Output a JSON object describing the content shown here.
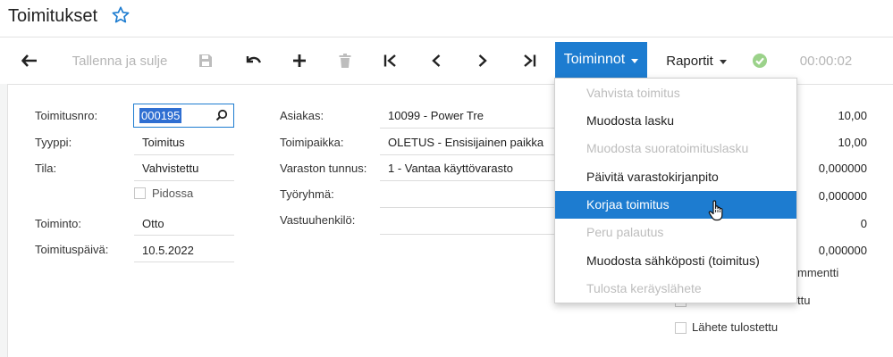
{
  "header": {
    "title": "Toimitukset",
    "favorite_icon": "star-outline-icon"
  },
  "toolbar": {
    "back_icon": "back-arrow-icon",
    "save_close": "Tallenna ja sulje",
    "save_icon": "floppy-disk-icon",
    "undo_icon": "undo-icon",
    "add_icon": "plus-icon",
    "delete_icon": "trash-icon",
    "first_icon": "first-record-icon",
    "prev_icon": "chevron-left-icon",
    "next_icon": "chevron-right-icon",
    "last_icon": "last-record-icon",
    "actions": "Toiminnot",
    "reports": "Raportit",
    "check_icon": "check-circle-icon",
    "timer": "00:00:02"
  },
  "colors": {
    "accent": "#1d7cd0",
    "check": "#9bd28a",
    "selection": "#2f6fd2"
  },
  "form": {
    "col1": {
      "delivery_no_label": "Toimitusnro:",
      "delivery_no_value": "000195",
      "type_label": "Tyyppi:",
      "type_value": "Toimitus",
      "status_label": "Tila:",
      "status_value": "Vahvistettu",
      "hold_label": "Pidossa",
      "operation_label": "Toiminto:",
      "operation_value": "Otto",
      "delivery_date_label": "Toimituspäivä:",
      "delivery_date_value": "10.5.2022"
    },
    "col2": {
      "customer_label": "Asiakas:",
      "customer_value": "10099 - Power Tre",
      "location_label": "Toimipaikka:",
      "location_value": "OLETUS - Ensisijainen paikka",
      "warehouse_label": "Varaston tunnus:",
      "warehouse_value": "1 - Vantaa käyttövarasto",
      "workgroup_label": "Työryhmä:",
      "owner_label": "Vastuuhenkilö:"
    },
    "col3": {
      "values": [
        "10,00",
        "10,00",
        "0,000000",
        "0,000000",
        "0",
        "0,000000"
      ],
      "comment_partial": "mmentti",
      "printed_partial": "ttu",
      "packing_slip_printed": "Lähete tulostettu"
    }
  },
  "actions_menu": {
    "items": [
      {
        "label": "Vahvista toimitus",
        "state": "disabled"
      },
      {
        "label": "Muodosta lasku",
        "state": "enabled"
      },
      {
        "label": "Muodosta suoratoimituslasku",
        "state": "disabled"
      },
      {
        "label": "Päivitä varastokirjanpito",
        "state": "enabled"
      },
      {
        "label": "Korjaa toimitus",
        "state": "active"
      },
      {
        "label": "Peru palautus",
        "state": "disabled"
      },
      {
        "label": "Muodosta sähköposti (toimitus)",
        "state": "enabled"
      },
      {
        "label": "Tulosta keräyslähete",
        "state": "disabled"
      }
    ]
  }
}
